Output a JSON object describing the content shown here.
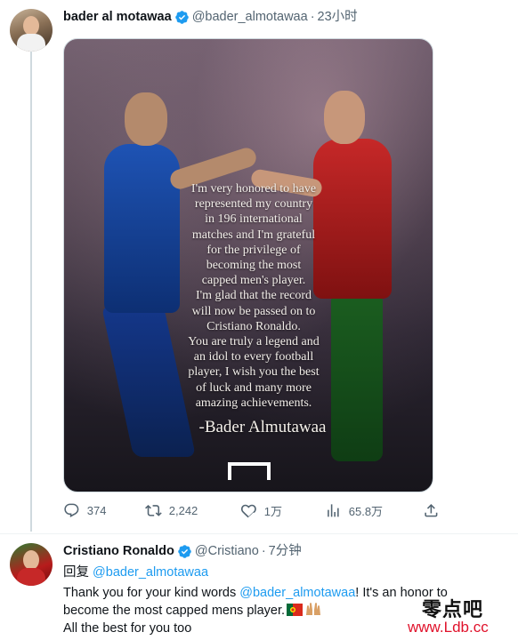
{
  "tweet1": {
    "author": {
      "display_name": "bader al motawaa",
      "handle": "@bader_almotawaa",
      "verified": true
    },
    "separator": "·",
    "timestamp": "23小时",
    "image": {
      "quote_lines": [
        "I'm very honored to have",
        "represented my country",
        "in 196  international",
        "matches and  I'm grateful",
        "for the privilege of",
        "becoming the most",
        "capped men's player.",
        "I'm glad that the record",
        "will now be passed on to",
        "Cristiano Ronaldo.",
        "You are truly a legend and",
        "an idol to every football",
        "player, I wish you the best",
        "of luck and many more",
        "amazing achievements."
      ],
      "signature": "-Bader Almutawaa"
    },
    "actions": {
      "replies": "374",
      "retweets": "2,242",
      "likes": "1万",
      "views": "65.8万"
    }
  },
  "tweet2": {
    "author": {
      "display_name": "Cristiano Ronaldo",
      "handle": "@Cristiano",
      "verified": true
    },
    "separator": "·",
    "timestamp": "7分钟",
    "reply_label": "回复",
    "reply_to": "@bader_almotawaa",
    "body": {
      "line1_pre": "Thank you for your kind words ",
      "line1_mention": "@bader_almotawaa",
      "line1_post": "! It's an honor to",
      "line2": "become the most capped mens player.",
      "line3": "All the best for you too"
    }
  },
  "watermark": {
    "top": "零点吧",
    "bottom": "www.Ldb.cc"
  },
  "colors": {
    "accent": "#1d9bf0",
    "secondary_text": "#536471",
    "divider": "#eff3f4",
    "watermark_red": "#e0122b"
  },
  "icons": [
    "verified-badge-icon",
    "reply-icon",
    "retweet-icon",
    "like-icon",
    "views-icon",
    "share-icon",
    "portugal-flag-icon",
    "raised-hands-icon"
  ]
}
